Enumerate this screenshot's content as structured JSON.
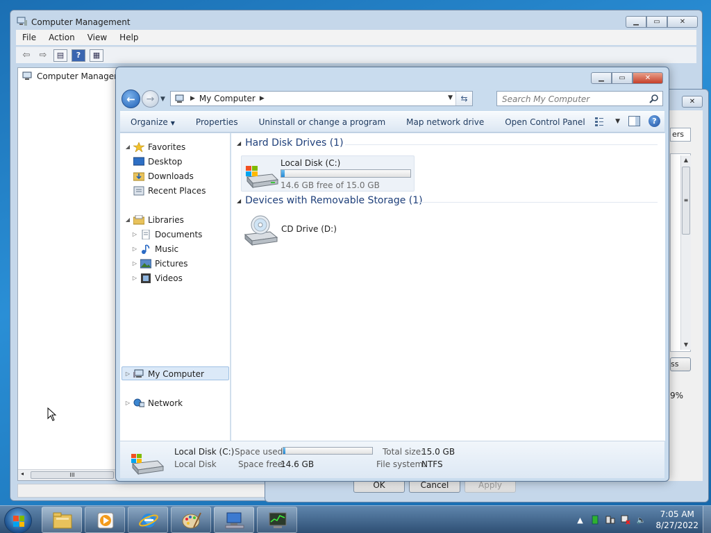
{
  "computer_management": {
    "title": "Computer Management",
    "menu": [
      "File",
      "Action",
      "View",
      "Help"
    ],
    "tree_root": "Computer Manageme",
    "scroll_thumb_grip": "III"
  },
  "properties_dialog": {
    "tab_partial": "ers",
    "button_partial": "ss",
    "percent_partial": "9%",
    "ok": "OK",
    "cancel": "Cancel",
    "apply": "Apply",
    "scroll_thumb_grip": "≡"
  },
  "explorer": {
    "address": [
      "My Computer"
    ],
    "search_placeholder": "Search My Computer",
    "commands": [
      "Organize",
      "Properties",
      "Uninstall or change a program",
      "Map network drive",
      "Open Control Panel"
    ],
    "nav": {
      "favorites": "Favorites",
      "desktop": "Desktop",
      "downloads": "Downloads",
      "recent": "Recent Places",
      "libraries": "Libraries",
      "documents": "Documents",
      "music": "Music",
      "pictures": "Pictures",
      "videos": "Videos",
      "my_computer": "My Computer",
      "network": "Network"
    },
    "groups": {
      "hdd": "Hard Disk Drives (1)",
      "removable": "Devices with Removable Storage (1)"
    },
    "local_disk": {
      "name": "Local Disk (C:)",
      "free_text": "14.6 GB free of 15.0 GB",
      "used_fraction": 0.027
    },
    "cd_drive": {
      "name": "CD Drive (D:)"
    },
    "details": {
      "name": "Local Disk (C:)",
      "type": "Local Disk",
      "space_used_label": "Space used:",
      "space_free_label": "Space free:",
      "space_free": "14.6 GB",
      "total_size_label": "Total size:",
      "total_size": "15.0 GB",
      "file_system_label": "File system:",
      "file_system": "NTFS"
    }
  },
  "taskbar": {
    "time": "7:05 AM",
    "date": "8/27/2022"
  },
  "colors": {
    "accent": "#1e3f7a",
    "selection": "#dbe9f8",
    "progress": "#2789d3"
  }
}
